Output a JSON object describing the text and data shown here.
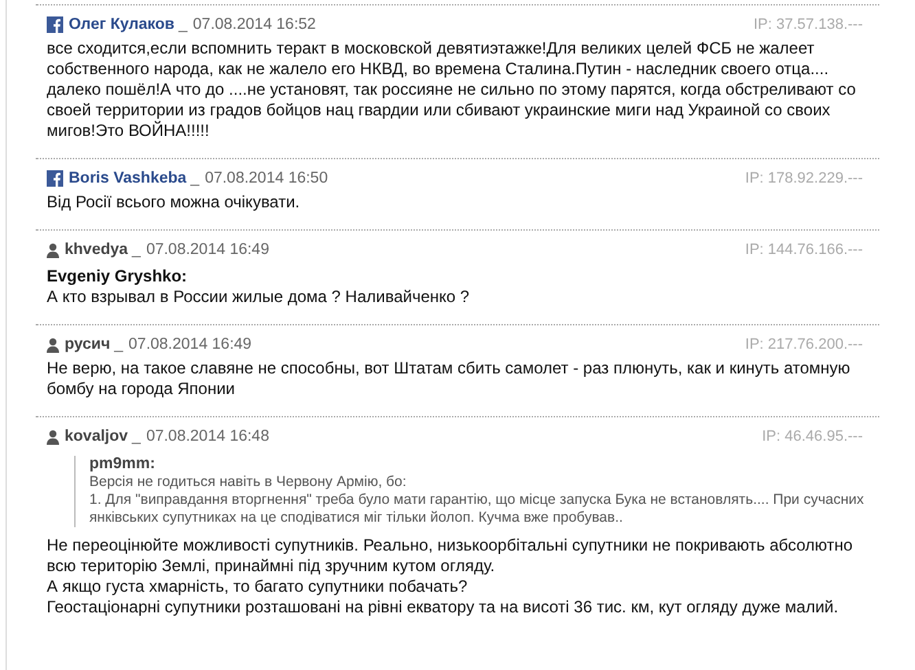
{
  "comments": [
    {
      "kind": "facebook",
      "author": "Олег Кулаков",
      "separator": "_",
      "date": "07.08.2014 16:52",
      "ip": "IP: 37.57.138.---",
      "paragraphs": [
        "все сходится,если вспомнить теракт в московской девятиэтажке!Для великих целей ФСБ не жалеет собственного народа, как не жалело его НКВД, во времена Сталина.Путин - наследник своего отца.... далеко пошёл!А что до ....не установят, так россияне не сильно по этому парятся, когда обстреливают со своей территории из градов бойцов нац гвардии или сбивают украинские миги над Украиной со своих мигов!Это ВОЙНА!!!!!"
      ]
    },
    {
      "kind": "facebook",
      "author": "Boris Vashkeba",
      "separator": "_",
      "date": "07.08.2014 16:50",
      "ip": "IP: 178.92.229.---",
      "paragraphs": [
        "Від Росії всього можна очікувати."
      ]
    },
    {
      "kind": "user",
      "author": "khvedya",
      "separator": "_",
      "date": "07.08.2014 16:49",
      "ip": "IP: 144.76.166.---",
      "reply_to": "Evgeniy Gryshko:",
      "paragraphs": [
        "А кто взрывал в России жилые дома ? Наливайченко ?"
      ]
    },
    {
      "kind": "user",
      "author": "русич",
      "separator": "_",
      "date": "07.08.2014 16:49",
      "ip": "IP: 217.76.200.---",
      "paragraphs": [
        "Не верю, на такое славяне не способны, вот Штатам сбить самолет - раз плюнуть, как и кинуть атомную бомбу на города Японии"
      ]
    },
    {
      "kind": "user",
      "author": "kovaljov",
      "separator": "_",
      "date": "07.08.2014 16:48",
      "ip": "IP: 46.46.95.---",
      "quote": {
        "author": "pm9mm:",
        "lines": [
          "Версія не годиться навіть в Червону Армію, бо:",
          "1. Для \"виправдання вторгнення\" треба було мати гарантію, що місце запуска Бука не встановлять.... При сучасних янківських супутниках на це сподіватися міг тільки йолоп. Кучма вже пробував.."
        ]
      },
      "paragraphs": [
        "Не переоцінюйте можливості супутників. Реально, низькоорбітальні супутники не покривають абсолютно всю територію Землі, принаймні під зручним кутом огляду.",
        "А якщо густа хмарність, то багато супутники побачать?",
        "Геостаціонарні супутники розташовані на рівні екватору та на висоті 36 тис. км, кут огляду дуже малий."
      ]
    }
  ]
}
